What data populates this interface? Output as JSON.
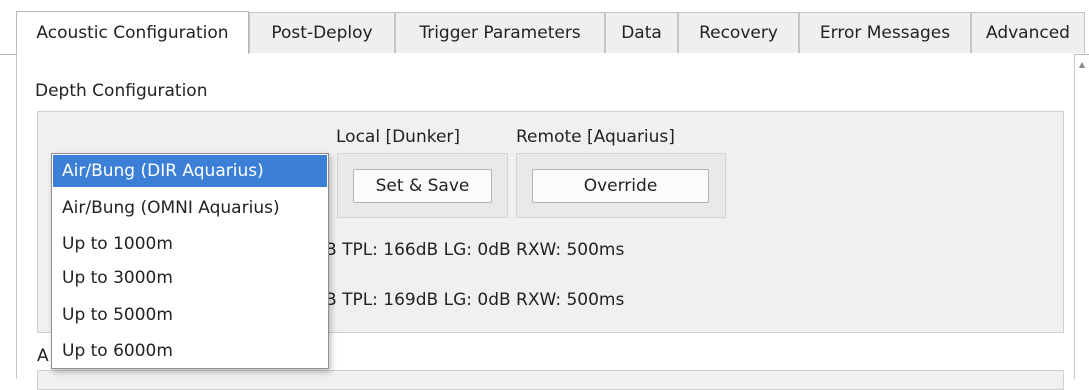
{
  "tabs": [
    {
      "label": "Acoustic Configuration",
      "active": true
    },
    {
      "label": "Post-Deploy",
      "active": false
    },
    {
      "label": "Trigger Parameters",
      "active": false
    },
    {
      "label": "Data",
      "active": false
    },
    {
      "label": "Recovery",
      "active": false
    },
    {
      "label": "Error Messages",
      "active": false
    },
    {
      "label": "Advanced",
      "active": false
    }
  ],
  "depth": {
    "title": "Depth Configuration",
    "local_label": "Local [Dunker]",
    "remote_label": "Remote [Aquarius]",
    "set_save_label": "Set & Save",
    "override_label": "Override",
    "info_line_1": "B  TPL: 166dB  LG: 0dB  RXW: 500ms",
    "info_line_2": "B  TPL: 169dB  LG: 0dB  RXW: 500ms"
  },
  "dropdown": {
    "options": [
      "Air/Bung (DIR Aquarius)",
      "Air/Bung (OMNI Aquarius)",
      "Up to 1000m",
      "Up to 3000m",
      "Up to 5000m",
      "Up to 6000m"
    ],
    "selected_index": 0
  },
  "lower_group_fragment": "A",
  "colors": {
    "selection": "#3c7fd6",
    "panel_bg": "#f0f0f0",
    "tab_inactive": "#efefef"
  },
  "icons": {
    "scroll_up": "scroll-up-arrow-icon"
  }
}
